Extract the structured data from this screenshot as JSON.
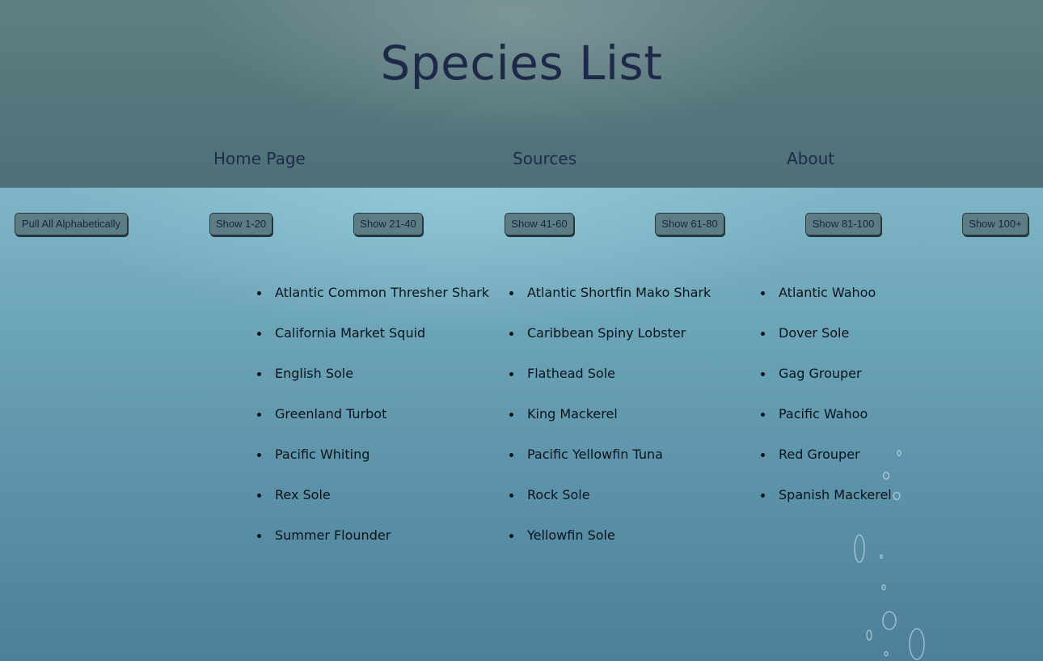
{
  "header": {
    "title": "Species List",
    "nav": [
      {
        "label": "Home Page"
      },
      {
        "label": "Sources"
      },
      {
        "label": "About"
      }
    ]
  },
  "filters": {
    "buttons": [
      {
        "label": "Pull All Alphabetically"
      },
      {
        "label": "Show 1-20"
      },
      {
        "label": "Show 21-40"
      },
      {
        "label": "Show 41-60"
      },
      {
        "label": "Show 61-80"
      },
      {
        "label": "Show 81-100"
      },
      {
        "label": "Show 100+"
      }
    ]
  },
  "species": {
    "columns": [
      [
        "Atlantic Common Thresher Shark",
        "California Market Squid",
        "English Sole",
        "Greenland Turbot",
        "Pacific Whiting",
        "Rex Sole",
        "Summer Flounder"
      ],
      [
        "Atlantic Shortfin Mako Shark",
        "Caribbean Spiny Lobster",
        "Flathead Sole",
        "King Mackerel",
        "Pacific Yellowfin Tuna",
        "Rock Sole",
        "Yellowfin Sole"
      ],
      [
        "Atlantic Wahoo",
        "Dover Sole",
        "Gag Grouper",
        "Pacific Wahoo",
        "Red Grouper",
        "Spanish Mackerel"
      ]
    ]
  },
  "colors": {
    "header_bg": "#55777c",
    "title_text": "#1e2848",
    "page_bg": "#6aa2b6",
    "button_bg": "#5d7d84"
  }
}
